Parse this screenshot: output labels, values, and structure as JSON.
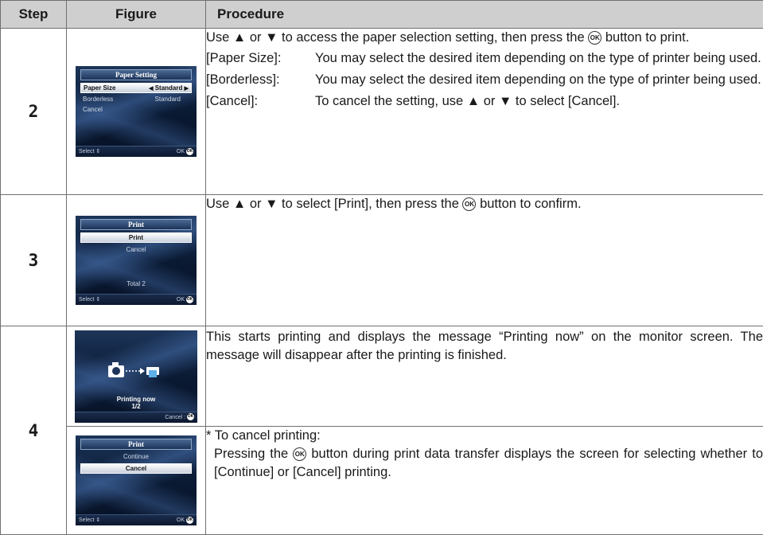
{
  "header": {
    "step": "Step",
    "figure": "Figure",
    "procedure": "Procedure"
  },
  "rows": [
    {
      "step": "2",
      "screen": {
        "title": "Paper Setting",
        "items": [
          {
            "label": "Paper Size",
            "value": "Standard",
            "selected": true
          },
          {
            "label": "Borderless",
            "value": "Standard",
            "selected": false
          },
          {
            "label": "Cancel",
            "value": "",
            "selected": false
          }
        ],
        "footer_left": "Select",
        "footer_right": "OK"
      },
      "intro": "Use ▲ or ▼ to access the paper selection setting, then press the",
      "intro_end": "button to print.",
      "ok_symbol": "OK",
      "definitions": [
        {
          "term": "[Paper Size]:",
          "desc": "You may select the desired item depending on the type of printer being used."
        },
        {
          "term": "[Borderless]:",
          "desc": "You may select the desired item depending on the type of printer being used."
        },
        {
          "term": "[Cancel]:",
          "desc": "To cancel the setting, use ▲ or ▼ to select [Cancel]."
        }
      ]
    },
    {
      "step": "3",
      "screen": {
        "title": "Print",
        "items": [
          "Print",
          "Cancel",
          "Total 2"
        ],
        "footer_left": "Select",
        "footer_right": "OK"
      },
      "text_before": "Use ▲ or ▼ to select [Print], then press the",
      "text_after": "button to confirm."
    },
    {
      "step": "4",
      "screen_a": {
        "message": "Printing now",
        "count": "1/2",
        "footer_right": "Cancel :"
      },
      "text_a": "This starts printing and displays the message “Printing now” on the monitor screen. The message will disappear after the printing is finished.",
      "screen_b": {
        "title": "Print",
        "items": [
          "Continue",
          "Cancel"
        ],
        "footer_left": "Select",
        "footer_right": "OK"
      },
      "note_title": "* To cancel printing:",
      "note_before": "Pressing the",
      "note_after": "button during print data transfer displays the screen for selecting whether to [Continue] or [Cancel] printing."
    }
  ]
}
